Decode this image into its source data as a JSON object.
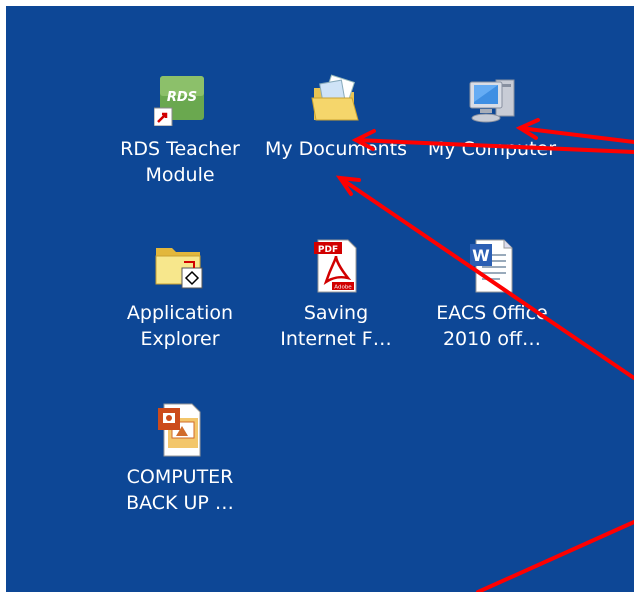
{
  "desktop": {
    "background": "#0d4796",
    "icons": [
      {
        "name": "rds-teacher-module",
        "label_line1": "RDS Teacher",
        "label_line2": "Module",
        "badge": "RDS",
        "icon": "rds-shortcut-icon"
      },
      {
        "name": "my-documents",
        "label_line1": "My Documents",
        "label_line2": "",
        "icon": "folder-documents-icon"
      },
      {
        "name": "my-computer",
        "label_line1": "My Computer",
        "label_line2": "",
        "icon": "computer-icon"
      },
      {
        "name": "application-explorer",
        "label_line1": "Application",
        "label_line2": "Explorer",
        "icon": "folder-shortcut-icon"
      },
      {
        "name": "saving-internet",
        "label_line1": "Saving",
        "label_line2": "Internet F…",
        "badge": "PDF",
        "badge2": "Adobe",
        "icon": "pdf-icon"
      },
      {
        "name": "eacs-office",
        "label_line1": "EACS Office",
        "label_line2": "2010 off…",
        "icon": "word-document-icon"
      },
      {
        "name": "computer-back-up",
        "label_line1": "COMPUTER",
        "label_line2": "BACK UP …",
        "icon": "powerpoint-icon"
      }
    ]
  },
  "annotation": {
    "arrow_color": "#ff0000"
  }
}
